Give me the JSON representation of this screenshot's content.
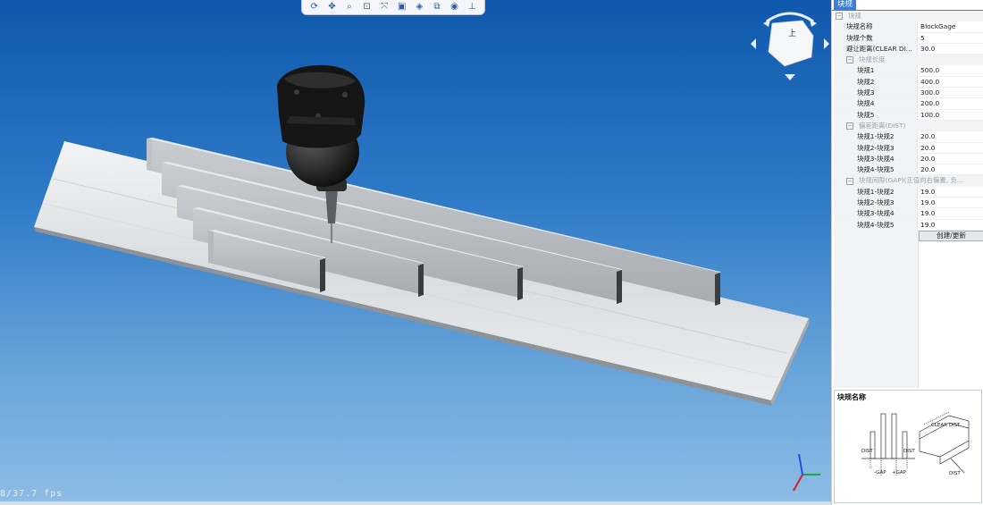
{
  "toolbar": {
    "tools": [
      {
        "name": "rotate-icon",
        "glyph": "⟳"
      },
      {
        "name": "pan-icon",
        "glyph": "✥"
      },
      {
        "name": "zoom-icon",
        "glyph": "⌕"
      },
      {
        "name": "zoom-window-icon",
        "glyph": "⊡"
      },
      {
        "name": "fit-all-icon",
        "glyph": "⤧"
      },
      {
        "name": "view-orientation-icon",
        "glyph": "▣"
      },
      {
        "name": "display-mode-icon",
        "glyph": "◈"
      },
      {
        "name": "section-view-icon",
        "glyph": "⧉"
      },
      {
        "name": "visibility-icon",
        "glyph": "◉"
      },
      {
        "name": "pin-icon",
        "glyph": "⊥"
      }
    ]
  },
  "viewport": {
    "fps": "8/37.7 fps"
  },
  "viewcube": {
    "face_label": "上"
  },
  "panel": {
    "tab": "块规",
    "root_category": "块规",
    "rows": [
      {
        "key": "块规名称",
        "value": "BlockGage"
      },
      {
        "key": "块规个数",
        "value": "5"
      },
      {
        "key": "避让距离(CLEAR DI...",
        "value": "30.0"
      }
    ],
    "length_category": "块规长度",
    "lengths": [
      {
        "key": "块规1",
        "value": "500.0"
      },
      {
        "key": "块规2",
        "value": "400.0"
      },
      {
        "key": "块规3",
        "value": "300.0"
      },
      {
        "key": "块规4",
        "value": "200.0"
      },
      {
        "key": "块规5",
        "value": "100.0"
      }
    ],
    "dist_category": "偏差距离(DIST)",
    "dists": [
      {
        "key": "块规1-块规2",
        "value": "20.0"
      },
      {
        "key": "块规2-块规3",
        "value": "20.0"
      },
      {
        "key": "块规3-块规4",
        "value": "20.0"
      },
      {
        "key": "块规4-块规5",
        "value": "20.0"
      }
    ],
    "gap_category": "块规间隙(GAP)(正值向右偏置, 负...",
    "gaps": [
      {
        "key": "块规1-块规2",
        "value": "19.0"
      },
      {
        "key": "块规2-块规3",
        "value": "19.0"
      },
      {
        "key": "块规3-块规4",
        "value": "19.0"
      },
      {
        "key": "块规4-块规5",
        "value": "19.0"
      }
    ],
    "create_button": "创建/更新"
  },
  "help": {
    "title": "块规名称",
    "labels": {
      "dist1": "DIST",
      "dist2": "DIST",
      "gap1": "-GAP",
      "gap2": "+GAP",
      "clear": "CLEAR DIST",
      "dist3": "DIST"
    }
  },
  "colors": {
    "accent": "#3b7fd6",
    "bg_top": "#0f58ad",
    "bg_bottom": "#8ebde6"
  }
}
